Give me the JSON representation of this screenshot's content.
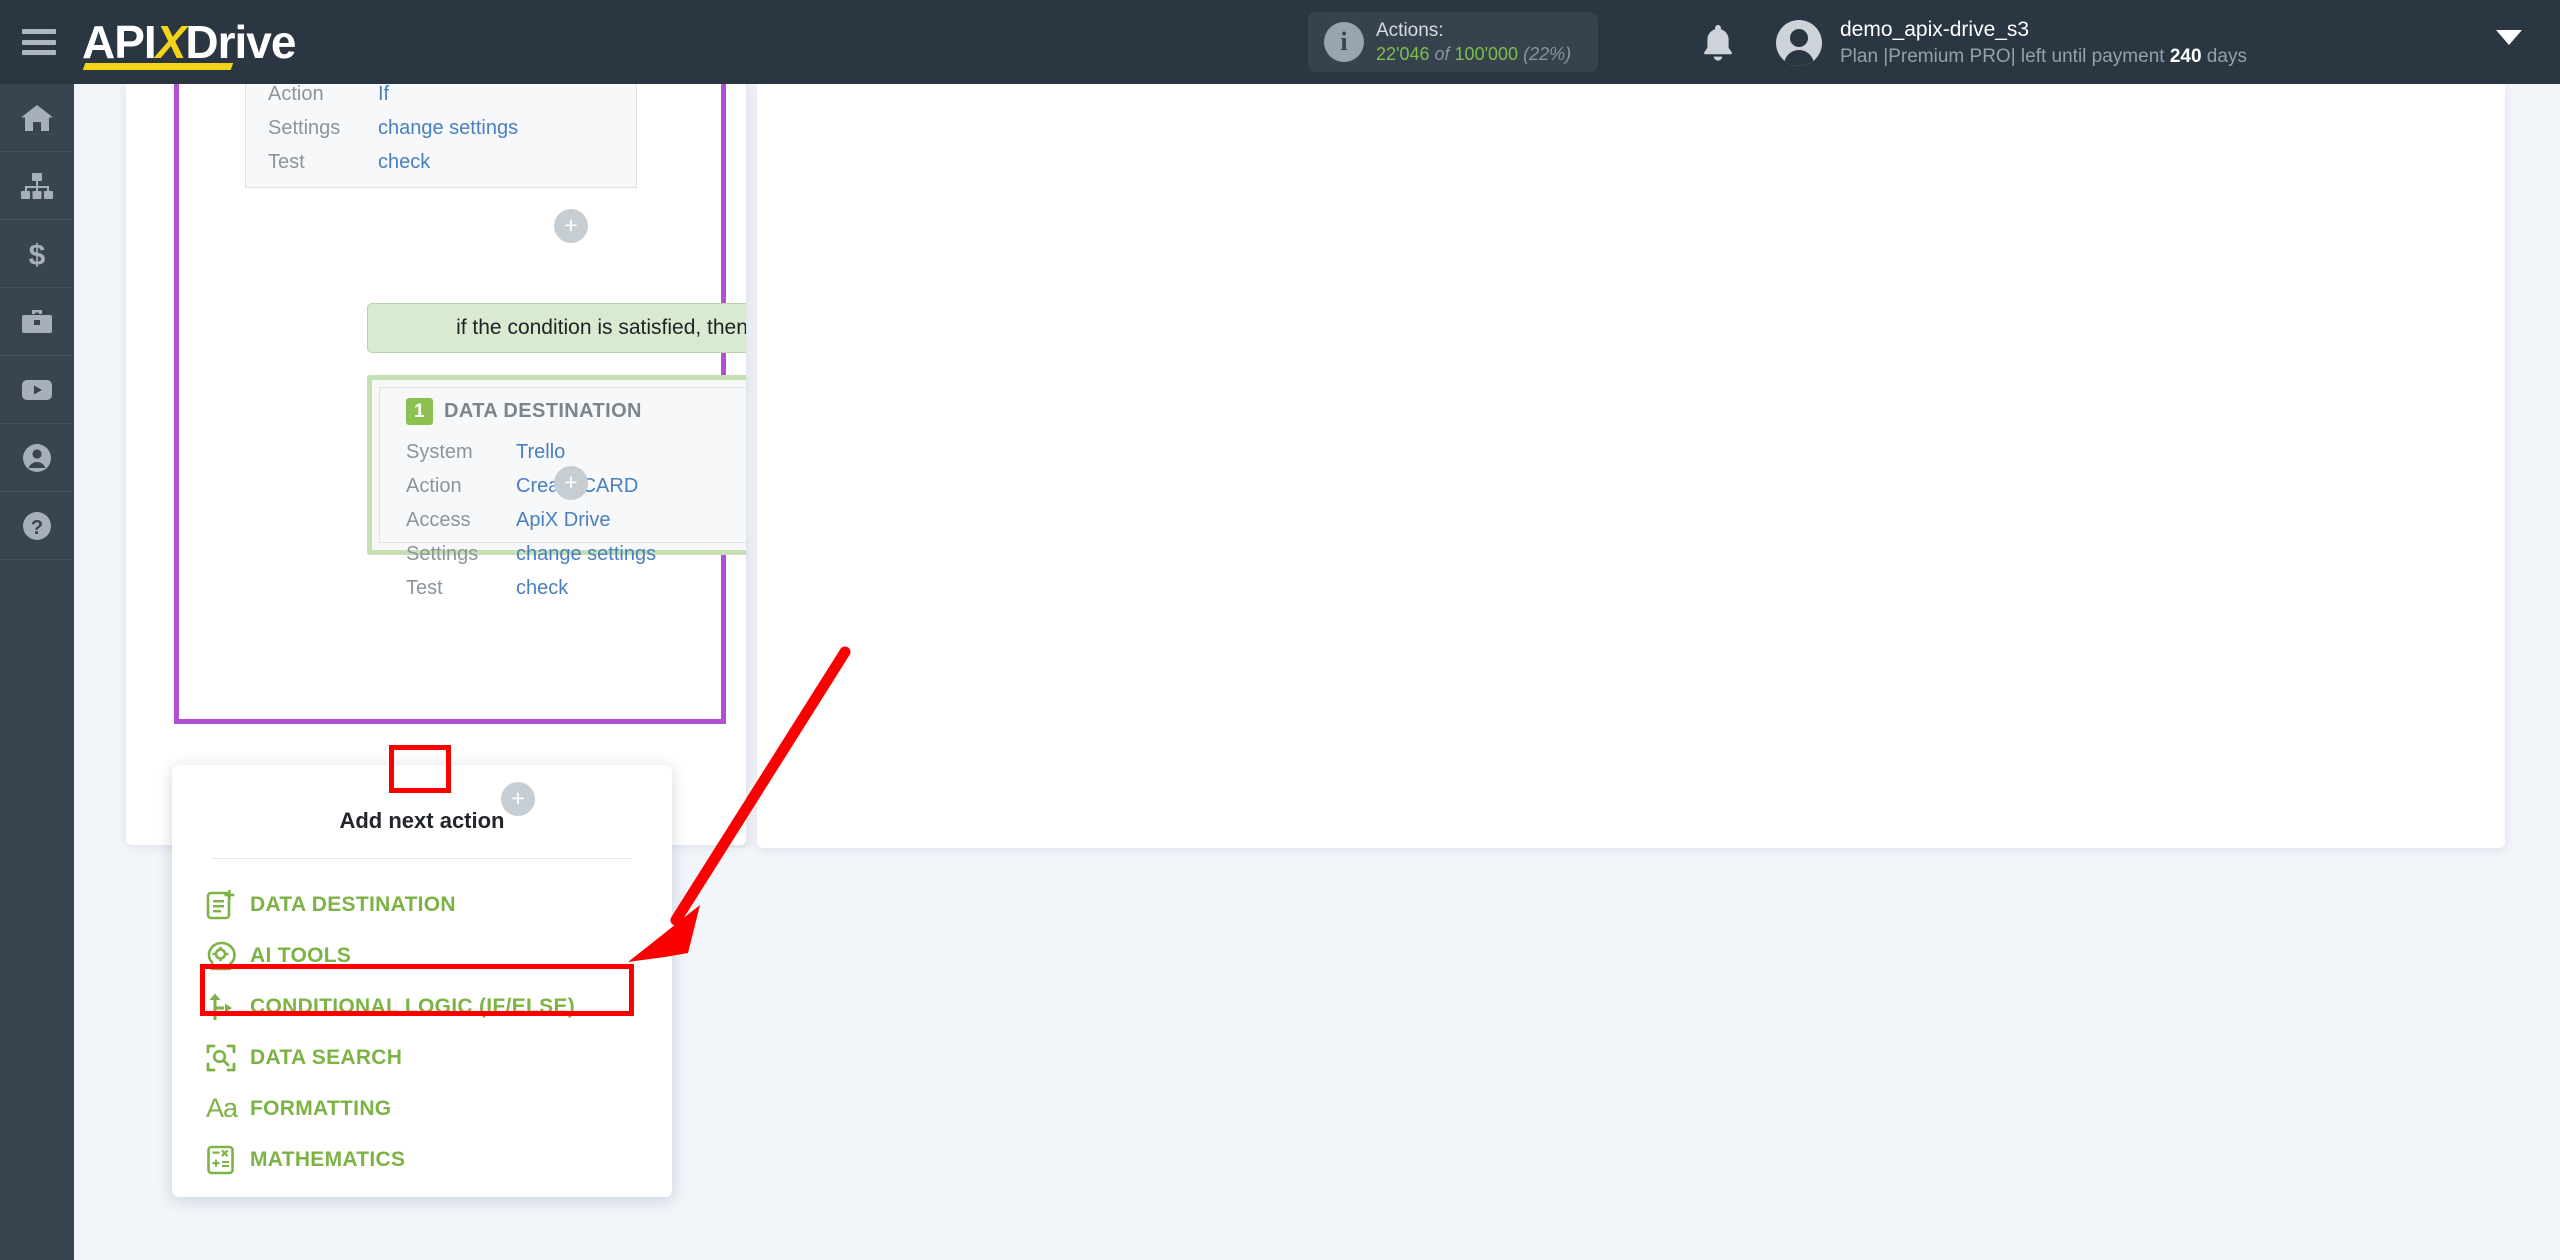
{
  "topbar": {
    "menu_icon": "hamburger-icon",
    "logo": {
      "part1": "API",
      "accent": "X",
      "part2": "Drive"
    },
    "actions": {
      "info_icon": "info-icon",
      "label": "Actions:",
      "used": "22'046",
      "of": "of",
      "total": "100'000",
      "percent": "(22%)"
    },
    "bell_icon": "bell-icon",
    "avatar_icon": "user-avatar-icon",
    "username": "demo_apix-drive_s3",
    "plan_prefix": "Plan |Premium PRO| left until payment ",
    "plan_days": "240",
    "plan_suffix": " days",
    "chevron_icon": "chevron-down-icon"
  },
  "sidebar": {
    "items": [
      {
        "name": "home",
        "icon": "home-icon"
      },
      {
        "name": "connections",
        "icon": "sitemap-icon"
      },
      {
        "name": "billing",
        "icon": "dollar-icon"
      },
      {
        "name": "business",
        "icon": "briefcase-icon"
      },
      {
        "name": "video",
        "icon": "youtube-icon"
      },
      {
        "name": "profile",
        "icon": "user-icon"
      },
      {
        "name": "help",
        "icon": "question-icon"
      }
    ]
  },
  "workflow": {
    "if_card": {
      "rows": [
        {
          "key": "Action",
          "value": "If"
        },
        {
          "key": "Settings",
          "value": "change settings"
        },
        {
          "key": "Test",
          "value": "check"
        }
      ]
    },
    "condition_bar": "if the condition is satisfied, then",
    "destination_card": {
      "badge": "1",
      "title": "DATA DESTINATION",
      "delete_icon": "trash-icon",
      "status_icon": "check-circle-icon",
      "rows": [
        {
          "key": "System",
          "value": "Trello"
        },
        {
          "key": "Action",
          "value": "Create CARD"
        },
        {
          "key": "Access",
          "value": "ApiX Drive"
        },
        {
          "key": "Settings",
          "value": "change settings"
        },
        {
          "key": "Test",
          "value": "check"
        }
      ]
    },
    "plus_label": "+"
  },
  "dropdown": {
    "title": "Add next action",
    "items": [
      {
        "label": "DATA DESTINATION",
        "icon": "document-plus-icon"
      },
      {
        "label": "AI TOOLS",
        "icon": "ai-head-gear-icon"
      },
      {
        "label": "CONDITIONAL LOGIC (IF/ELSE)",
        "icon": "branch-icon"
      },
      {
        "label": "DATA SEARCH",
        "icon": "search-scan-icon"
      },
      {
        "label": "FORMATTING",
        "icon": "Aa"
      },
      {
        "label": "MATHEMATICS",
        "icon": "calculator-icon"
      }
    ]
  },
  "annotations": {
    "highlight_plus": "red-box-around-add-button",
    "highlight_conditional": "red-box-around-conditional-logic",
    "arrow": "red-arrow-pointing-to-conditional-logic"
  },
  "colors": {
    "topbar_bg": "#2a3642",
    "rail_bg": "#38444f",
    "accent_yellow": "#f5d316",
    "green": "#7cb344",
    "purple_border": "#b150d6",
    "annotation_red": "#fc0000",
    "link_blue": "#4a7fbf",
    "page_bg": "#f2f5fa"
  }
}
